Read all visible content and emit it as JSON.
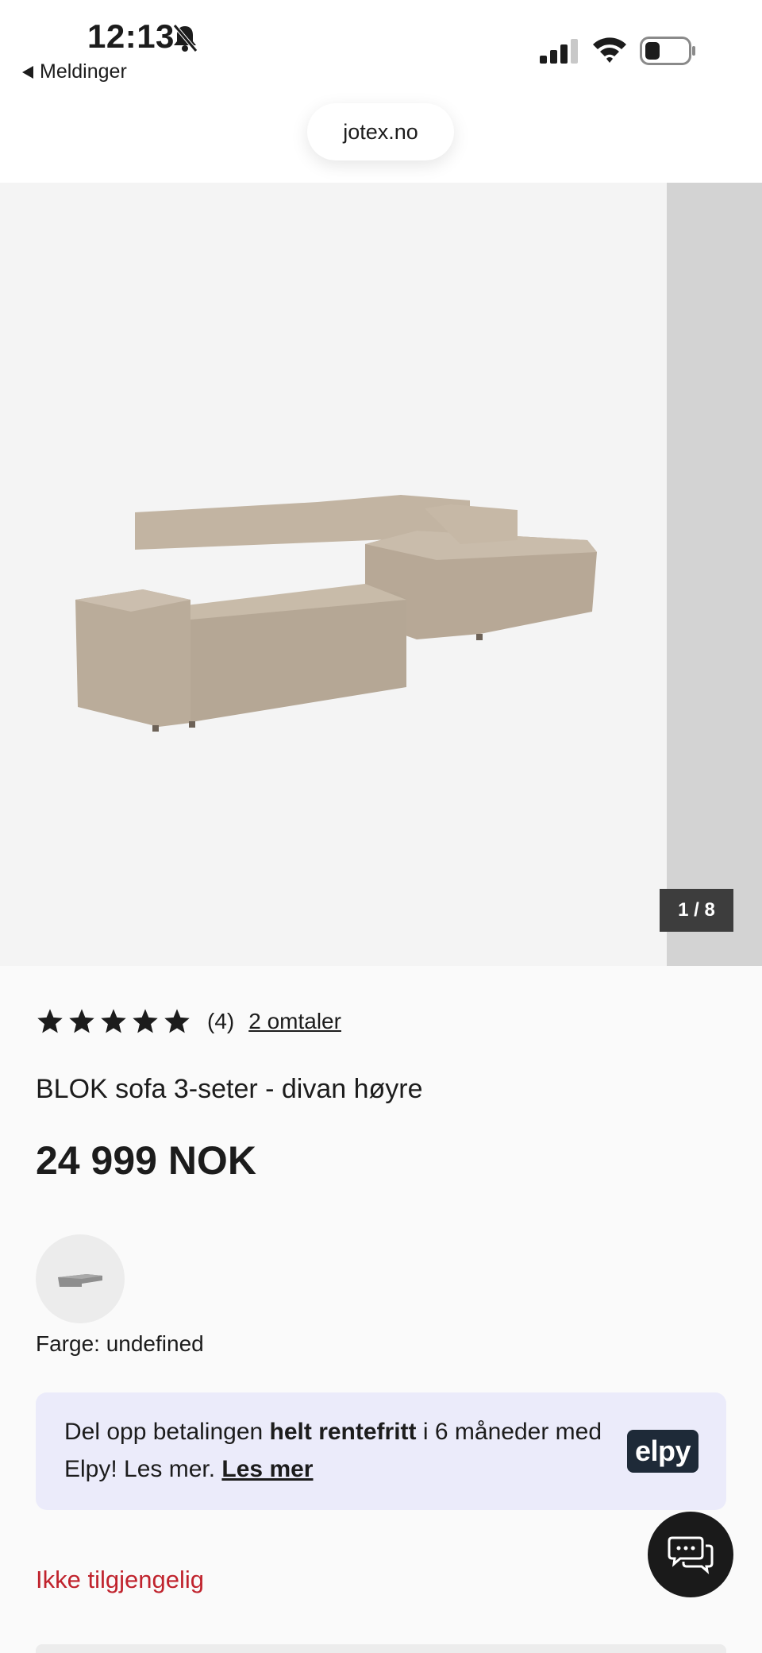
{
  "status_bar": {
    "time": "12:13",
    "back_label": "Meldinger",
    "icons": [
      "bell-slash-icon",
      "signal-icon",
      "wifi-icon",
      "battery-icon"
    ]
  },
  "browser": {
    "url": "jotex.no"
  },
  "gallery": {
    "counter": "1 / 8",
    "image": "sofa-product-image"
  },
  "product": {
    "rating_stars": 5,
    "rating_count": "(4)",
    "reviews_link": "2 omtaler",
    "title": "BLOK sofa 3-seter - divan høyre",
    "price": "24 999 NOK",
    "color_label": "Farge: undefined"
  },
  "elpy": {
    "text_before": "Del opp betalingen ",
    "text_bold": "helt rentefritt",
    "text_after": " i 6 måneder med Elpy! Les mer. ",
    "read_more": "Les mer",
    "logo": "elpy"
  },
  "availability": "Ikke tilgjengelig",
  "colors": {
    "unavailable": "#c0232d",
    "banner_bg": "#ebebfa",
    "elpy_logo_bg": "#1e2a38",
    "chat_button": "#1a1a1a"
  }
}
